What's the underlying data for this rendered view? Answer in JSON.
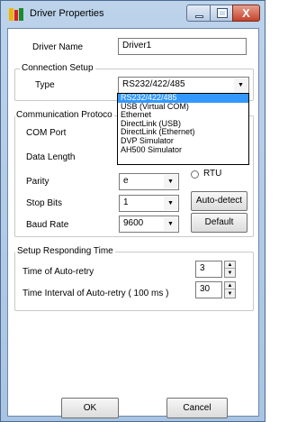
{
  "window": {
    "title": "Driver Properties",
    "minimize": "minimize",
    "maximize": "maximize",
    "close": "X"
  },
  "driver": {
    "name_label": "Driver Name",
    "name_value": "Driver1"
  },
  "connection": {
    "group_label": "Connection Setup",
    "type_label": "Type",
    "type_value": "RS232/422/485",
    "options": [
      "RS232/422/485",
      "USB (Virtual COM)",
      "Ethernet",
      "DirectLink (USB)",
      "DirectLink (Ethernet)",
      "DVP Simulator",
      "AH500 Simulator"
    ]
  },
  "communication": {
    "group_label": "Communication Protoco",
    "com_port_label": "COM Port",
    "data_length_label": "Data Length",
    "parity_label": "Parity",
    "parity_value": "e",
    "rtu_label": "RTU",
    "stop_bits_label": "Stop Bits",
    "stop_bits_value": "1",
    "auto_detect_label": "Auto-detect",
    "baud_rate_label": "Baud Rate",
    "baud_rate_value": "9600",
    "default_label": "Default"
  },
  "responding": {
    "group_label": "Setup Responding Time",
    "auto_retry_label": "Time of Auto-retry",
    "auto_retry_value": "3",
    "interval_label": "Time Interval of Auto-retry ( 100 ms )",
    "interval_value": "30"
  },
  "footer": {
    "ok_label": "OK",
    "cancel_label": "Cancel"
  }
}
